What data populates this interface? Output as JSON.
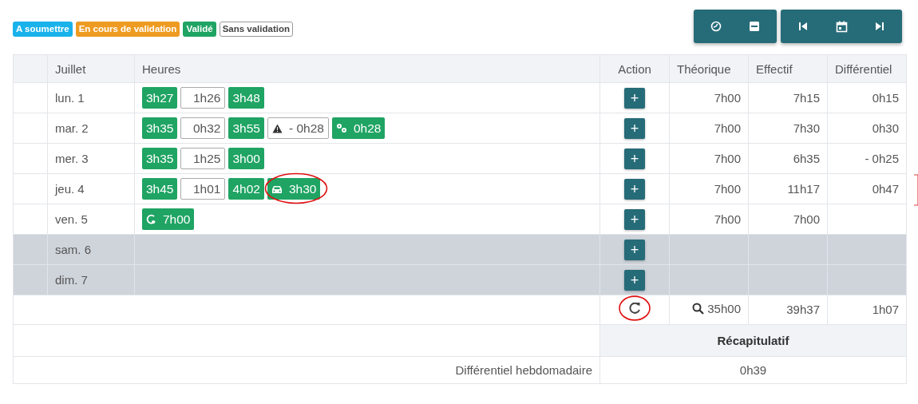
{
  "legend": [
    {
      "label": "A soumettre",
      "kind": "submit"
    },
    {
      "label": "En cours de validation",
      "kind": "pending"
    },
    {
      "label": "Validé",
      "kind": "validated"
    },
    {
      "label": "Sans validation",
      "kind": "none"
    }
  ],
  "toolbar": [
    {
      "kind": "timer"
    },
    {
      "kind": "pdf"
    },
    {
      "kind": "first"
    },
    {
      "kind": "calendar"
    },
    {
      "kind": "last"
    }
  ],
  "table": {
    "columns": [
      "Juillet",
      "Heures",
      "Action",
      "Théorique",
      "Effectif",
      "Différentiel"
    ],
    "rows": [
      {
        "day": "lun. 1",
        "weekend": false,
        "bracketed": false,
        "chips": [
          {
            "kind": "validated",
            "text": "3h27"
          },
          {
            "kind": "break",
            "text": "1h26"
          },
          {
            "kind": "validated",
            "text": "3h48"
          }
        ],
        "action": "+",
        "theorique": "7h00",
        "effectif": "7h15",
        "differentiel": "0h15"
      },
      {
        "day": "mar. 2",
        "weekend": false,
        "bracketed": false,
        "chips": [
          {
            "kind": "validated",
            "text": "3h35"
          },
          {
            "kind": "break",
            "text": "0h32"
          },
          {
            "kind": "validated",
            "text": "3h55"
          },
          {
            "kind": "alert",
            "text": "- 0h28"
          },
          {
            "kind": "adjustment",
            "text": "0h28"
          }
        ],
        "action": "+",
        "theorique": "7h00",
        "effectif": "7h30",
        "differentiel": "0h30"
      },
      {
        "day": "mer. 3",
        "weekend": false,
        "bracketed": false,
        "chips": [
          {
            "kind": "validated",
            "text": "3h35"
          },
          {
            "kind": "break",
            "text": "1h25"
          },
          {
            "kind": "validated",
            "text": "3h00"
          }
        ],
        "action": "+",
        "theorique": "7h00",
        "effectif": "6h35",
        "differentiel": "- 0h25"
      },
      {
        "day": "jeu. 4",
        "weekend": false,
        "bracketed": true,
        "chips": [
          {
            "kind": "validated",
            "text": "3h45"
          },
          {
            "kind": "break",
            "text": "1h01"
          },
          {
            "kind": "validated",
            "text": "4h02"
          },
          {
            "kind": "travel",
            "text": "3h30",
            "circled": true
          }
        ],
        "action": "+",
        "theorique": "7h00",
        "effectif": "11h17",
        "differentiel": "0h47"
      },
      {
        "day": "ven. 5",
        "weekend": false,
        "bracketed": false,
        "chips": [
          {
            "kind": "auto",
            "text": "7h00"
          }
        ],
        "action": "+",
        "theorique": "7h00",
        "effectif": "7h00"
      },
      {
        "day": "sam. 6",
        "weekend": true,
        "bracketed": false,
        "chips": [],
        "action": "+"
      },
      {
        "day": "dim. 7",
        "weekend": true,
        "bracketed": false,
        "chips": [],
        "action": "+"
      }
    ],
    "totals": {
      "refresh_circled": true,
      "theorique": "35h00",
      "effectif": "39h37",
      "differentiel": "1h07"
    },
    "summary": {
      "title": "Récapitulatif",
      "label": "Différentiel hebdomadaire",
      "value": "0h39"
    }
  }
}
